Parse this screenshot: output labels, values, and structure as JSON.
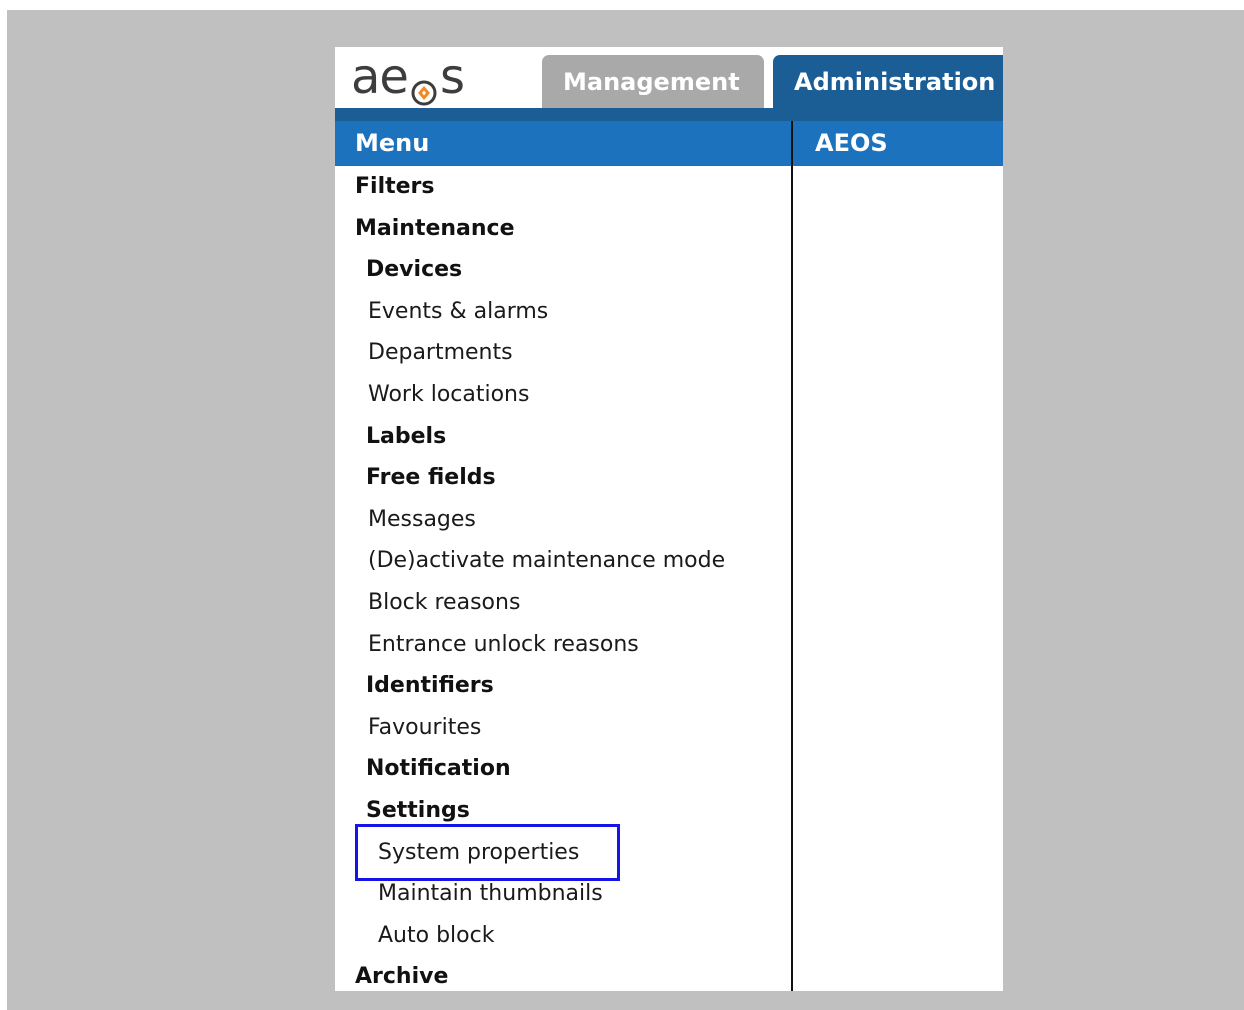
{
  "app": {
    "logo_text_left": "ae",
    "logo_text_right": "s",
    "brand_color": "#1c72bd",
    "accent_color": "#f08a24"
  },
  "tabs": [
    {
      "label": "Management",
      "active": false
    },
    {
      "label": "Administration",
      "active": true
    }
  ],
  "header": {
    "menu_title": "Menu",
    "content_title": "AEOS"
  },
  "menu": {
    "items": [
      {
        "label": "Filters",
        "level": 0
      },
      {
        "label": "Maintenance",
        "level": 0
      },
      {
        "label": "Devices",
        "level": 1
      },
      {
        "label": "Events & alarms",
        "level": 2
      },
      {
        "label": "Departments",
        "level": 2
      },
      {
        "label": "Work locations",
        "level": 2
      },
      {
        "label": "Labels",
        "level": 1
      },
      {
        "label": "Free fields",
        "level": 1
      },
      {
        "label": "Messages",
        "level": 2
      },
      {
        "label": "(De)activate maintenance mode",
        "level": 2
      },
      {
        "label": "Block reasons",
        "level": 2
      },
      {
        "label": "Entrance unlock reasons",
        "level": 2
      },
      {
        "label": "Identifiers",
        "level": 1
      },
      {
        "label": "Favourites",
        "level": 2
      },
      {
        "label": "Notification",
        "level": 1
      },
      {
        "label": "Settings",
        "level": 1
      },
      {
        "label": "System properties",
        "level": 3,
        "highlighted": true
      },
      {
        "label": "Maintain thumbnails",
        "level": 3
      },
      {
        "label": "Auto block",
        "level": 3
      },
      {
        "label": "Archive",
        "level": 0
      }
    ]
  }
}
